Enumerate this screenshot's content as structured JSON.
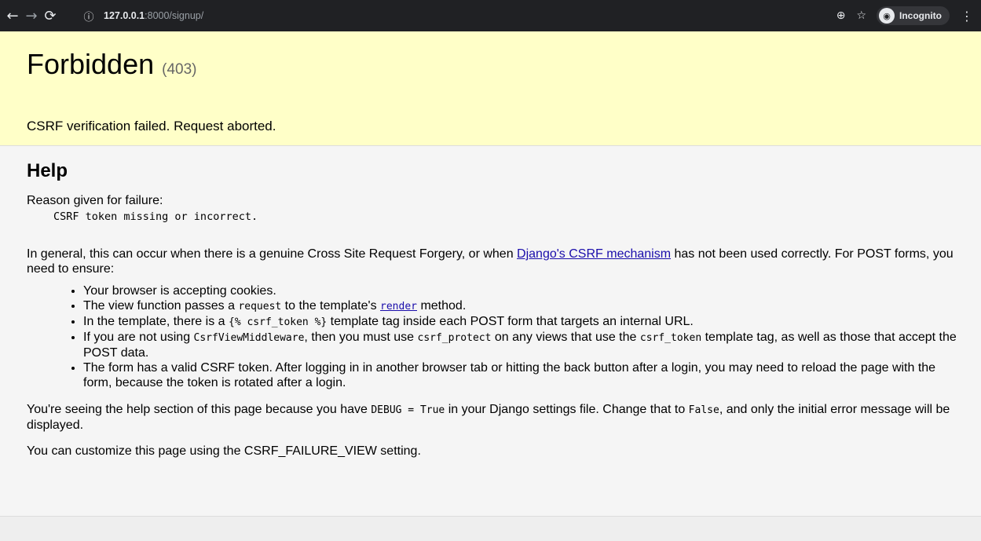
{
  "browser": {
    "url_host": "127.0.0.1",
    "url_rest": ":8000/signup/",
    "incognito_label": "Incognito",
    "icons": [
      "back-icon",
      "forward-icon",
      "reload-icon",
      "info-icon",
      "zoom-icon",
      "star-icon",
      "incognito-icon",
      "menu-icon"
    ]
  },
  "summary": {
    "title": "Forbidden",
    "code": "(403)",
    "message": "CSRF verification failed. Request aborted."
  },
  "help": {
    "heading": "Help",
    "reason_label": "Reason given for failure:",
    "reason_text": "CSRF token missing or incorrect.",
    "general_before_link": "In general, this can occur when there is a genuine Cross Site Request Forgery, or when ",
    "general_link": "Django's CSRF mechanism",
    "general_after_link": " has not been used correctly. For POST forms, you need to ensure:",
    "items": [
      {
        "t1": "Your browser is accepting cookies."
      },
      {
        "t1": "The view function passes a ",
        "c1": "request",
        "t2": " to the template's ",
        "l1": "render",
        "t3": " method."
      },
      {
        "t1": "In the template, there is a ",
        "c1": "{% csrf_token %}",
        "t2": " template tag inside each POST form that targets an internal URL."
      },
      {
        "t1": "If you are not using ",
        "c1": "CsrfViewMiddleware",
        "t2": ", then you must use ",
        "c2": "csrf_protect",
        "t3": " on any views that use the ",
        "c3": "csrf_token",
        "t4": " template tag, as well as those that accept the POST data."
      },
      {
        "t1": "The form has a valid CSRF token. After logging in in another browser tab or hitting the back button after a login, you may need to reload the page with the form, because the token is rotated after a login."
      }
    ],
    "debug_t1": "You're seeing the help section of this page because you have ",
    "debug_c1": "DEBUG = True",
    "debug_t2": " in your Django settings file. Change that to ",
    "debug_c2": "False",
    "debug_t3": ", and only the initial error message will be displayed.",
    "customize": "You can customize this page using the CSRF_FAILURE_VIEW setting."
  }
}
